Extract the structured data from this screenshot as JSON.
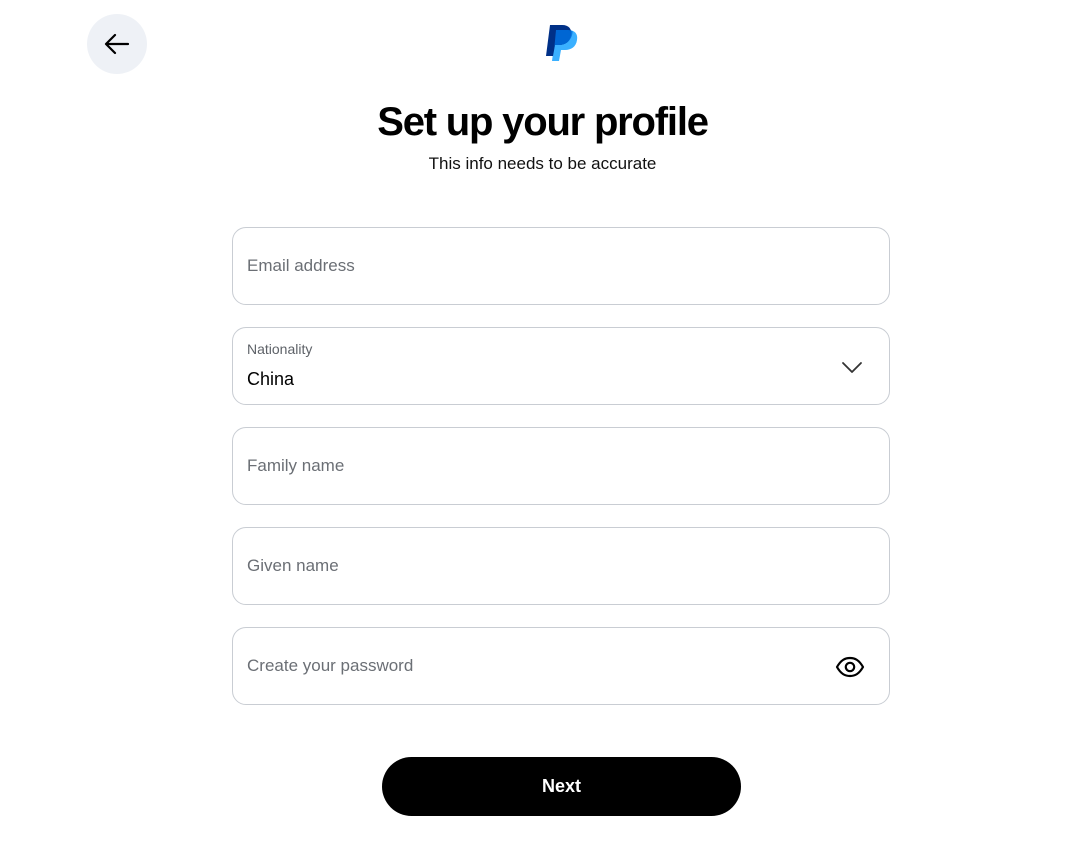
{
  "header": {
    "back_icon": "arrow-left-icon",
    "logo_icon": "paypal-logo-icon",
    "title": "Set up your profile",
    "subtitle": "This info needs to be accurate"
  },
  "form": {
    "email": {
      "placeholder": "Email address",
      "value": ""
    },
    "nationality": {
      "label": "Nationality",
      "value": "China",
      "icon": "chevron-down-icon"
    },
    "family_name": {
      "placeholder": "Family name",
      "value": ""
    },
    "given_name": {
      "placeholder": "Given name",
      "value": ""
    },
    "password": {
      "placeholder": "Create your password",
      "value": "",
      "icon": "eye-icon"
    }
  },
  "actions": {
    "next_label": "Next"
  },
  "colors": {
    "back_button_bg": "#eef1f6",
    "field_border": "#c9cdd3",
    "primary_button": "#000000",
    "paypal_dark_blue": "#003087",
    "paypal_light_blue": "#3ab0ff"
  }
}
